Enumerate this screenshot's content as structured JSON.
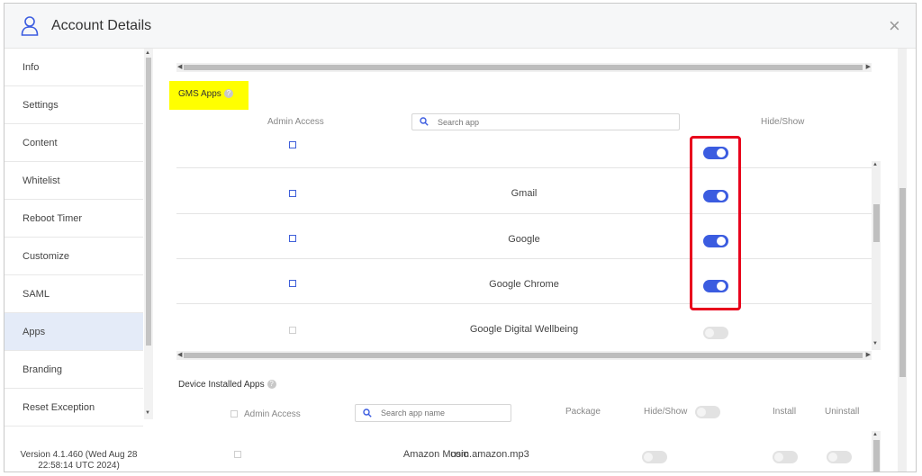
{
  "header": {
    "title": "Account Details",
    "user_icon": "user-icon",
    "close_glyph": "×"
  },
  "sidebar": {
    "items": [
      {
        "label": "Info"
      },
      {
        "label": "Settings"
      },
      {
        "label": "Content"
      },
      {
        "label": "Whitelist"
      },
      {
        "label": "Reboot Timer"
      },
      {
        "label": "Customize"
      },
      {
        "label": "SAML"
      },
      {
        "label": "Apps",
        "active": true
      },
      {
        "label": "Branding"
      },
      {
        "label": "Reset Exception"
      }
    ],
    "version": "Version 4.1.460 (Wed Aug 28 22:58:14 UTC 2024)"
  },
  "gms": {
    "label": "GMS Apps",
    "admin_access_header": "Admin Access",
    "hide_show_header": "Hide/Show",
    "search_placeholder": "Search app",
    "rows": [
      {
        "name": "",
        "checkbox_enabled": true,
        "visible": true
      },
      {
        "name": "Gmail",
        "checkbox_enabled": true,
        "visible": true
      },
      {
        "name": "Google",
        "checkbox_enabled": true,
        "visible": true
      },
      {
        "name": "Google Chrome",
        "checkbox_enabled": true,
        "visible": true
      },
      {
        "name": "Google Digital Wellbeing",
        "checkbox_enabled": false,
        "visible": false
      }
    ]
  },
  "device": {
    "label": "Device Installed Apps",
    "admin_access_header": "Admin Access",
    "search_placeholder": "Search app name",
    "package_header": "Package",
    "hide_show_header": "Hide/Show",
    "install_header": "Install",
    "uninstall_header": "Uninstall",
    "rows": [
      {
        "name": "Amazon Music",
        "package": "com.amazon.mp3"
      }
    ]
  },
  "colors": {
    "accent": "#3b5ce0",
    "highlight": "#ffff00",
    "annotation": "#e8001c",
    "active_nav": "#e4ebf8"
  }
}
